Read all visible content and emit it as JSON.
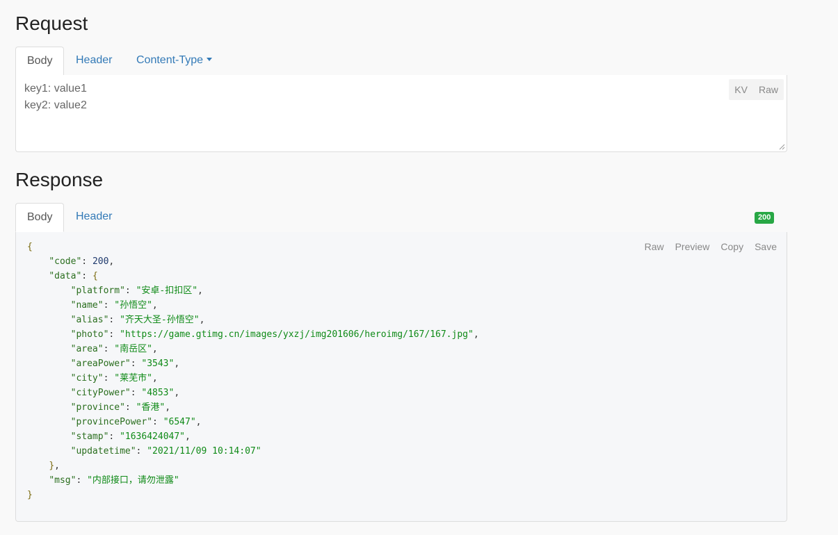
{
  "request": {
    "title": "Request",
    "tabs": [
      {
        "label": "Body",
        "active": true
      },
      {
        "label": "Header",
        "active": false
      },
      {
        "label": "Content-Type",
        "active": false,
        "dropdown": true
      }
    ],
    "body_lines": [
      "key1: value1",
      "key2: value2"
    ],
    "mode_buttons": [
      "KV",
      "Raw"
    ]
  },
  "response": {
    "title": "Response",
    "tabs": [
      {
        "label": "Body",
        "active": true
      },
      {
        "label": "Header",
        "active": false
      }
    ],
    "status_badge": "200",
    "actions": [
      "Raw",
      "Preview",
      "Copy",
      "Save"
    ],
    "json": {
      "code": "200",
      "data": [
        {
          "key": "platform",
          "value": "安卓-扣扣区"
        },
        {
          "key": "name",
          "value": "孙悟空"
        },
        {
          "key": "alias",
          "value": "齐天大圣-孙悟空"
        },
        {
          "key": "photo",
          "value": "https://game.gtimg.cn/images/yxzj/img201606/heroimg/167/167.jpg"
        },
        {
          "key": "area",
          "value": "南岳区"
        },
        {
          "key": "areaPower",
          "value": "3543"
        },
        {
          "key": "city",
          "value": "莱芜市"
        },
        {
          "key": "cityPower",
          "value": "4853"
        },
        {
          "key": "province",
          "value": "香港"
        },
        {
          "key": "provincePower",
          "value": "6547"
        },
        {
          "key": "stamp",
          "value": "1636424047"
        },
        {
          "key": "updatetime",
          "value": "2021/11/09 10:14:07"
        }
      ],
      "msg": "内部接口，请勿泄露"
    }
  },
  "colors": {
    "link": "#337ab7",
    "badge": "#28a745"
  }
}
